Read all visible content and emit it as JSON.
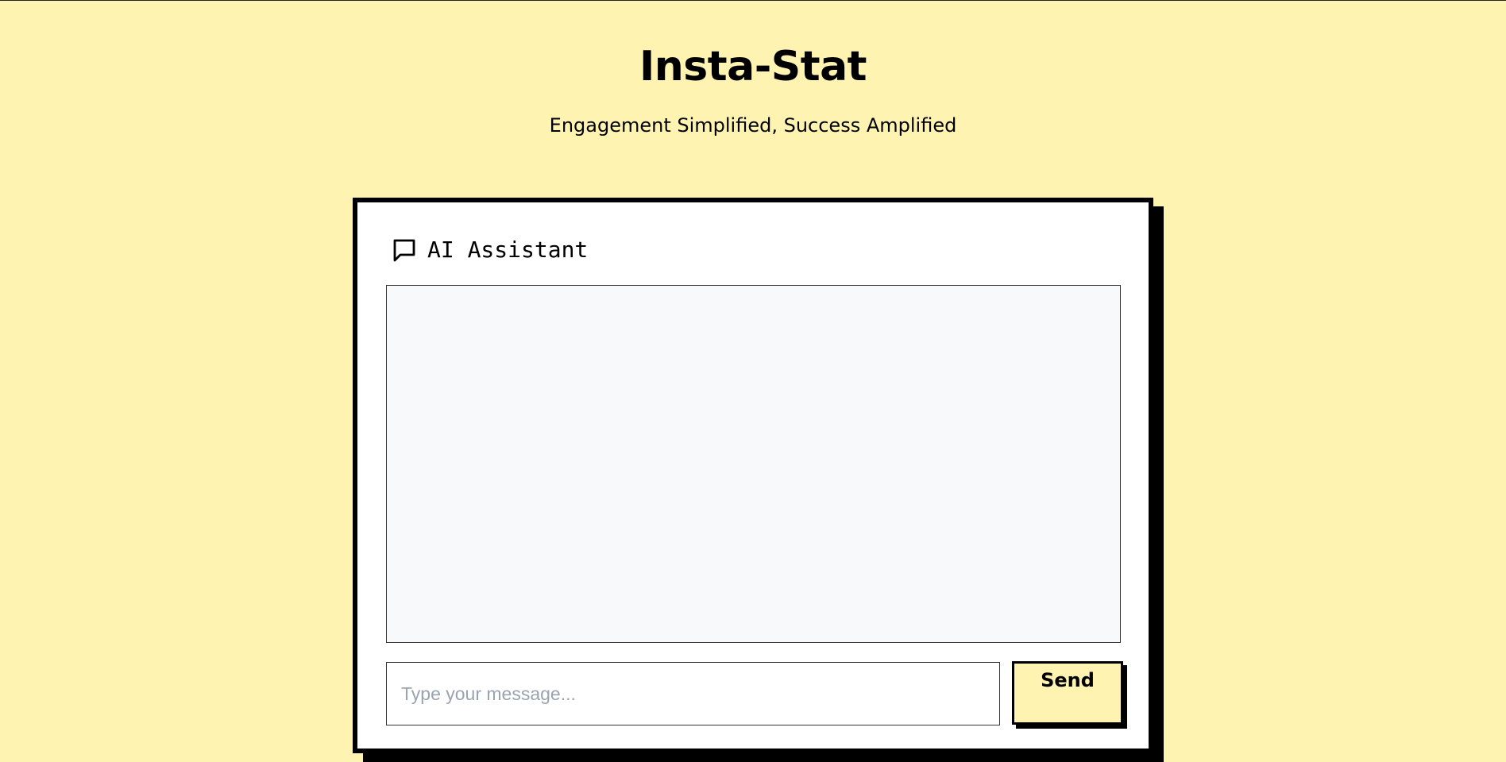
{
  "header": {
    "title": "Insta-Stat",
    "subtitle": "Engagement Simplified, Success Amplified"
  },
  "assistant": {
    "title": "AI Assistant",
    "icon": "chat-bubble-icon",
    "messages": [],
    "input": {
      "value": "",
      "placeholder": "Type your message..."
    },
    "send_label": "Send"
  },
  "colors": {
    "background": "#fef3b1",
    "card": "#ffffff",
    "chat_log": "#f8f9fb",
    "border": "#000000",
    "send_button": "#fef3b1",
    "placeholder": "#9aa3b0"
  }
}
